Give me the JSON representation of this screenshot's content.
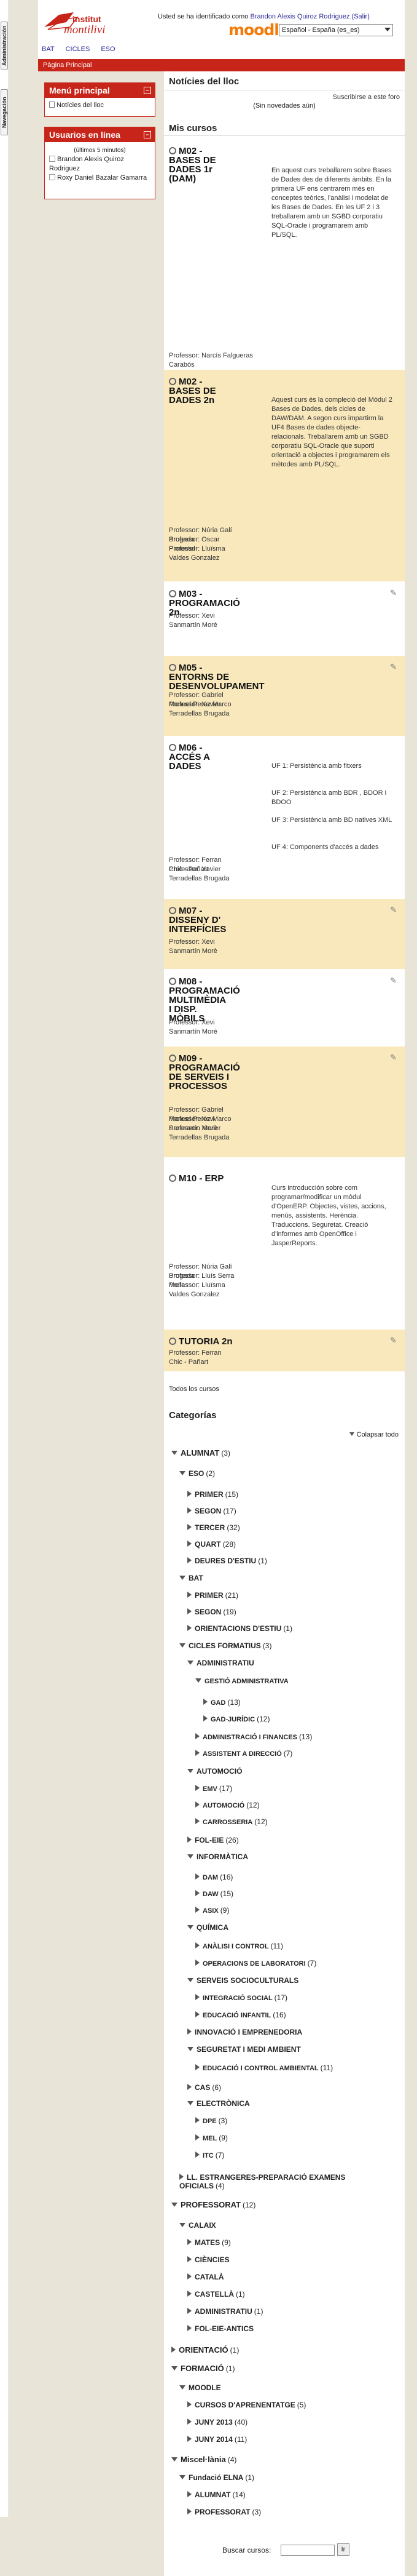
{
  "dock": {
    "tab1": "Administración",
    "tab2": "Navegación"
  },
  "header": {
    "logo_top": "institut",
    "logo_main": "montilivi",
    "login_prefix": "Usted se ha identificado como",
    "login_user": "Brandon Alexis Quiroz Rodriguez",
    "login_exit": "(Salir)",
    "moodle": "moodle",
    "language": "Español - España (es_es)"
  },
  "navbar": [
    "BAT",
    "CICLES",
    "ESO"
  ],
  "breadcrumb": "Pàgina Principal",
  "blocks": {
    "main_menu": {
      "title": "Menú principal",
      "item": "Notícies del lloc"
    },
    "online": {
      "title": "Usuarios en línea",
      "period": "(últimos 5 minutos)",
      "users": [
        "Brandon Alexis Quiroz Rodriguez",
        "Roxy Daniel Bazalar Gamarra"
      ]
    }
  },
  "news": {
    "title": "Notícies del lloc",
    "subscribe": "Suscribirse a este foro",
    "empty": "(Sin novedades aún)"
  },
  "mycourses_title": "Mis cursos",
  "courses": [
    {
      "title": "M02 - BASES DE DADES 1r (DAM)",
      "desc": "En aquest curs treballarem sobre Bases de Dades des de diferents àmbits. En la primera UF ens centrarem més en conceptes teòrics, l'anàlisi i modelat de les Bases de Dades. En les UF 2 i 3 treballarem amb un SGBD corporatiu SQL-Oracle i programarem amb PL/SQL.",
      "teachers": [
        "Professor: Narcís Falgueras Carabós"
      ]
    },
    {
      "title": "M02 - BASES DE DADES 2n",
      "desc": "Aquest curs és la compleció del Mòdul 2 Bases de Dades, dels cicles de DAW/DAM. A segon curs impartirm la UF4 Bases de dades objecte-relacionals. Treballarem amb un SGBD corporatiu SQL-Oracle que suporti orientació a objectes i programarem els mètodes amb PL/SQL.",
      "teachers": [
        "Professor: Núria Galí Brugada",
        "Professor: Oscar Pimentel",
        "Professor: Lluïsma Valdes Gonzalez"
      ]
    },
    {
      "title": "M03 - PROGRAMACIÓ 2n",
      "desc": "",
      "teachers": [
        "Professor: Xevi Sanmartín Morè"
      ]
    },
    {
      "title": "M05 - ENTORNS DE DESENVOLUPAMENT",
      "desc": "",
      "teachers": [
        "Professor: Gabriel Manuel Perez Marco",
        "Professor: Xavier Terradellas Brugada"
      ]
    },
    {
      "title": "M06 - ACCÉS A DADES",
      "desc_lines": [
        "UF 1: Persistència amb fitxers",
        "UF 2: Persistència amb BDR , BDOR i BDOO",
        "UF 3: Persistència amb BD natives XML",
        "UF 4: Components d'accés a dades"
      ],
      "teachers": [
        "Professor: Ferran Chic - Pañart",
        "Professor: Xavier Terradellas Brugada"
      ]
    },
    {
      "title": "M07 - DISSENY D' INTERFÍCIES",
      "desc": "",
      "teachers": [
        "Professor: Xevi Sanmartín Morè"
      ]
    },
    {
      "title": "M08 - PROGRAMACIÓ MULTIMÈDIA I DISP. MÒBILS",
      "desc": "",
      "teachers": [
        "Professor: Xevi Sanmartín Morè"
      ]
    },
    {
      "title": "M09 - PROGRAMACIÓ DE SERVEIS I PROCESSOS",
      "desc": "",
      "teachers": [
        "Professor: Gabriel Manuel Perez Marco",
        "Professor: Xevi Sanmartín Morè",
        "Professor: Xavier Terradellas Brugada"
      ]
    },
    {
      "title": "M10 - ERP",
      "desc": "Curs introducción sobre com programar/modificar un mòdul d'OpenERP. Objectes, vistes, accions, menús, assistents. Herència. Traduccions. Seguretat. Creació d'informes amb OpenOffice i JasperReports.",
      "teachers": [
        "Professor: Núria Galí Brugada",
        "Professor: Lluís Serra Mollas",
        "Professor: Lluïsma Valdes Gonzalez"
      ]
    },
    {
      "title": "TUTORIA 2n",
      "desc": "",
      "teachers": [
        "Professor: Ferran Chic - Pañart"
      ]
    }
  ],
  "all_courses": "Todos los cursos",
  "categories_title": "Categorías",
  "collapse_all": "Colapsar todo",
  "categories": [
    {
      "name": "ALUMNAT",
      "count": "(3)"
    },
    {
      "name": "ESO",
      "count": "(2)"
    },
    {
      "name": "PRIMER",
      "count": "(15)"
    },
    {
      "name": "SEGON",
      "count": "(17)"
    },
    {
      "name": "TERCER",
      "count": "(32)"
    },
    {
      "name": "QUART",
      "count": "(28)"
    },
    {
      "name": "DEURES D'ESTIU",
      "count": "(1)"
    },
    {
      "name": "BAT",
      "count": ""
    },
    {
      "name": "PRIMER",
      "count": "(21)"
    },
    {
      "name": "SEGON",
      "count": "(19)"
    },
    {
      "name": "ORIENTACIONS D'ESTIU",
      "count": "(1)"
    },
    {
      "name": "CICLES FORMATIUS",
      "count": "(3)"
    },
    {
      "name": "ADMINISTRATIU",
      "count": ""
    },
    {
      "name": "GESTIÓ ADMINISTRATIVA",
      "count": ""
    },
    {
      "name": "GAD",
      "count": "(13)"
    },
    {
      "name": "GAD-JURÍDIC",
      "count": "(12)"
    },
    {
      "name": "ADMINISTRACIÓ I FINANCES",
      "count": "(13)"
    },
    {
      "name": "ASSISTENT A DIRECCIÓ",
      "count": "(7)"
    },
    {
      "name": "AUTOMOCIÓ",
      "count": ""
    },
    {
      "name": "EMV",
      "count": "(17)"
    },
    {
      "name": "AUTOMOCIÓ",
      "count": "(12)"
    },
    {
      "name": "CARROSSERIA",
      "count": "(12)"
    },
    {
      "name": "FOL-EIE",
      "count": "(26)"
    },
    {
      "name": "INFORMÀTICA",
      "count": ""
    },
    {
      "name": "DAM",
      "count": "(16)"
    },
    {
      "name": "DAW",
      "count": "(15)"
    },
    {
      "name": "ASIX",
      "count": "(9)"
    },
    {
      "name": "QUÍMICA",
      "count": ""
    },
    {
      "name": "ANÀLISI I CONTROL",
      "count": "(11)"
    },
    {
      "name": "OPERACIONS DE LABORATORI",
      "count": "(7)"
    },
    {
      "name": "SERVEIS SOCIOCULTURALS",
      "count": ""
    },
    {
      "name": "INTEGRACIÓ SOCIAL",
      "count": "(17)"
    },
    {
      "name": "EDUCACIÓ INFANTIL",
      "count": "(16)"
    },
    {
      "name": "INNOVACIÓ I EMPRENEDORIA",
      "count": ""
    },
    {
      "name": "SEGURETAT I MEDI AMBIENT",
      "count": ""
    },
    {
      "name": "EDUCACIÓ I CONTROL AMBIENTAL",
      "count": "(11)"
    },
    {
      "name": "CAS",
      "count": "(6)"
    },
    {
      "name": "ELECTRÒNICA",
      "count": ""
    },
    {
      "name": "DPE",
      "count": "(3)"
    },
    {
      "name": "MEL",
      "count": "(9)"
    },
    {
      "name": "ITC",
      "count": "(7)"
    },
    {
      "name": "LL. ESTRANGERES-PREPARACIÓ EXAMENS OFICIALS",
      "count": "(4)"
    },
    {
      "name": "PROFESSORAT",
      "count": "(12)"
    },
    {
      "name": "CALAIX",
      "count": ""
    },
    {
      "name": "MATES",
      "count": "(9)"
    },
    {
      "name": "CIÈNCIES",
      "count": ""
    },
    {
      "name": "CATALÀ",
      "count": ""
    },
    {
      "name": "CASTELLÀ",
      "count": "(1)"
    },
    {
      "name": "ADMINISTRATIU",
      "count": "(1)"
    },
    {
      "name": "FOL-EIE-ANTICS",
      "count": ""
    },
    {
      "name": "ORIENTACIÓ",
      "count": "(1)"
    },
    {
      "name": "FORMACIÓ",
      "count": "(1)"
    },
    {
      "name": "MOODLE",
      "count": ""
    },
    {
      "name": "CURSOS D'APRENENTATGE",
      "count": "(5)"
    },
    {
      "name": "JUNY 2013",
      "count": "(40)"
    },
    {
      "name": "JUNY 2014",
      "count": "(11)"
    },
    {
      "name": "Miscel·lània",
      "count": "(4)"
    },
    {
      "name": "Fundació ELNA",
      "count": "(1)"
    },
    {
      "name": "ALUMNAT",
      "count": "(14)"
    },
    {
      "name": "PROFESSORAT",
      "count": "(3)"
    }
  ],
  "search": {
    "label": "Buscar cursos:",
    "button": "Ir"
  }
}
